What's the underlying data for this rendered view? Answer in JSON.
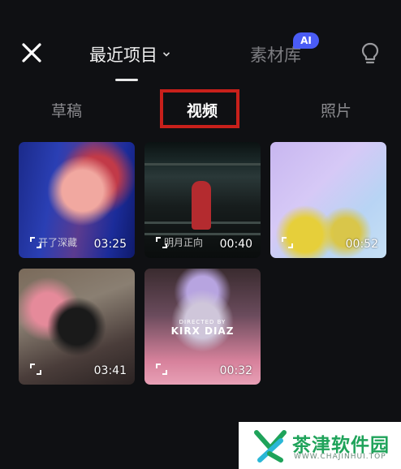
{
  "header": {
    "close_icon": "close-icon",
    "recent_tab_label": "最近项目",
    "library_tab_label": "素材库",
    "ai_badge": "AI",
    "tips_icon": "lightbulb-icon"
  },
  "subtabs": {
    "drafts": "草稿",
    "video": "视频",
    "photos": "照片",
    "selected": "视频"
  },
  "media": [
    {
      "duration": "03:25",
      "caption": "开了深藏"
    },
    {
      "duration": "00:40",
      "caption": "明月正向"
    },
    {
      "duration": "00:52"
    },
    {
      "duration": "03:41"
    },
    {
      "duration": "00:32",
      "overlay_small": "DIRECTED BY",
      "overlay_title": "KIRX DIAZ"
    }
  ],
  "watermark": {
    "name": "茶津软件园",
    "url": "WWW.CHAJINHUI.TOP"
  },
  "colors": {
    "background": "#0f1013",
    "highlight_box": "#c8201b",
    "ai_badge": "#4a5cf5",
    "watermark_green": "#1fa35a"
  }
}
